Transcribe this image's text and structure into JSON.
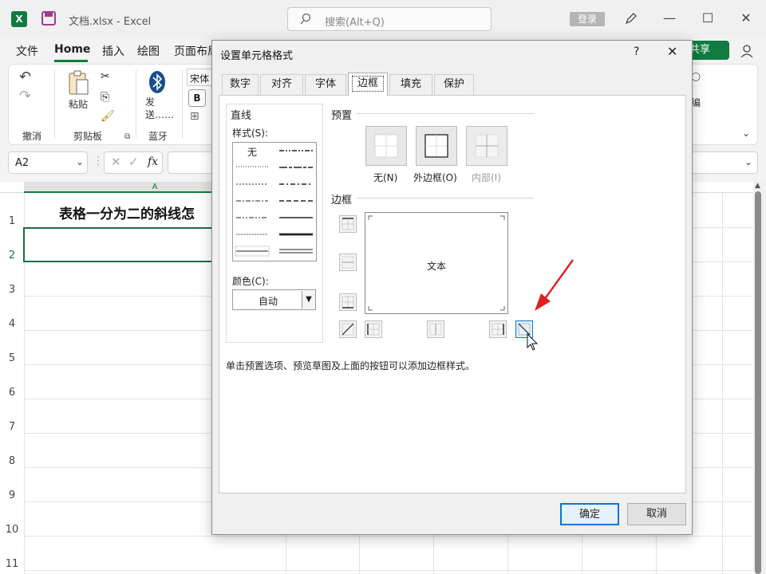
{
  "window": {
    "doc_title": "文档.xlsx  -  Excel",
    "search_placeholder": "搜索(Alt+Q)",
    "login_label": "登录",
    "share_label": "共享"
  },
  "menu": [
    "文件",
    "Home",
    "插入",
    "绘图",
    "页面布局"
  ],
  "ribbon": {
    "undo_group": "撤消",
    "paste_label": "粘贴",
    "clipboard_group": "剪贴板",
    "send_label": "发送……",
    "bluetooth_group": "蓝牙",
    "font_name": "宋体",
    "bold_label": "B",
    "edit_label": "编"
  },
  "formula_bar": {
    "namebox": "A2"
  },
  "sheet": {
    "col_a": "A",
    "title_cell": "表格一分为二的斜线怎",
    "rows": [
      "1",
      "2",
      "3",
      "4",
      "5",
      "6",
      "7",
      "8",
      "9",
      "10",
      "11"
    ]
  },
  "dialog": {
    "title": "设置单元格格式",
    "help": "?",
    "close": "✕",
    "tabs": [
      "数字",
      "对齐",
      "字体",
      "边框",
      "填充",
      "保护"
    ],
    "active_tab": "边框",
    "line_group": "直线",
    "style_label": "样式(S):",
    "style_none": "无",
    "color_label": "颜色(C):",
    "color_value": "自动",
    "preset_group": "预置",
    "preset_none": "无(N)",
    "preset_outline": "外边框(O)",
    "preset_inside": "内部(I)",
    "border_group": "边框",
    "preview_text": "文本",
    "hint": "单击预置选项、预览草图及上面的按钮可以添加边框样式。",
    "ok": "确定",
    "cancel": "取消"
  },
  "colors": {
    "excel_green": "#107c41",
    "annotation_arrow": "#e02020",
    "focus_blue": "#0078d7"
  }
}
